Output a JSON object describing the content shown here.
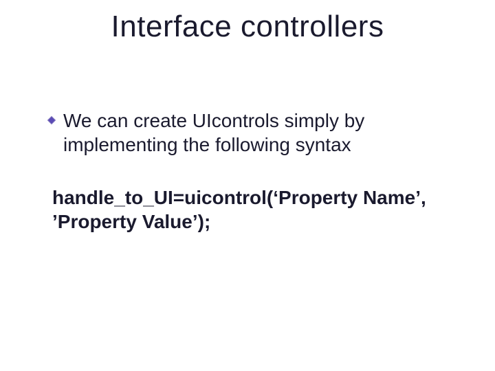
{
  "slide": {
    "title": "Interface controllers",
    "bullet": "We can create UIcontrols simply by implementing the following syntax",
    "code": "handle_to_UI=uicontrol(‘Property Name’, ’Property Value’);"
  }
}
